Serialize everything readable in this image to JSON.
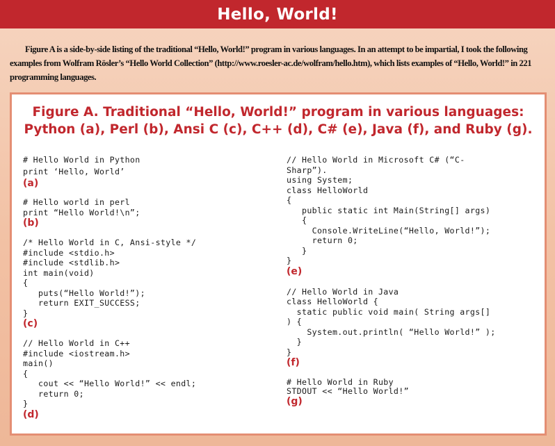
{
  "header": {
    "title": "Hello, World!"
  },
  "intro": {
    "text": "Figure A is a side-by-side listing of the traditional “Hello, World!” program in various languages. In an attempt to be impartial, I took the following examples from Wolfram Rösler’s “Hello World Collection” (http://www.roesler-ac.de/wolfram/hello.htm), which lists examples of “Hello, World!” in 221 programming languages."
  },
  "figure": {
    "caption_line1": "Figure A. Traditional “Hello, World!” program in various languages:",
    "caption_line2": "Python (a), Perl (b), Ansi C (c), C++ (d), C# (e), Java (f), and Ruby (g).",
    "examples": {
      "python": {
        "code": "# Hello World in Python\nprint ‘Hello, World’",
        "label": "(a)"
      },
      "perl": {
        "code": "# Hello world in perl\nprint “Hello World!\\n”;",
        "label": "(b)"
      },
      "c": {
        "code": "/* Hello World in C, Ansi-style */\n#include <stdio.h>\n#include <stdlib.h>\nint main(void)\n{\n   puts(“Hello World!”);\n   return EXIT_SUCCESS;\n}",
        "label": "(c)"
      },
      "cpp": {
        "code": "// Hello World in C++\n#include <iostream.h>\nmain()\n{\n   cout << “Hello World!” << endl;\n   return 0;\n}",
        "label": "(d)"
      },
      "csharp": {
        "code": "// Hello World in Microsoft C# (“C-\nSharp”).\nusing System;\nclass HelloWorld\n{\n   public static int Main(String[] args)\n   {\n     Console.WriteLine(“Hello, World!”);\n     return 0;\n   }\n}",
        "label": "(e)"
      },
      "java": {
        "code": "// Hello World in Java\nclass HelloWorld {\n  static public void main( String args[]\n) {\n    System.out.println( “Hello World!” );\n  }\n}",
        "label": "(f)"
      },
      "ruby": {
        "code": "# Hello World in Ruby\nSTDOUT << “Hello World!”",
        "label": "(g)"
      }
    }
  }
}
